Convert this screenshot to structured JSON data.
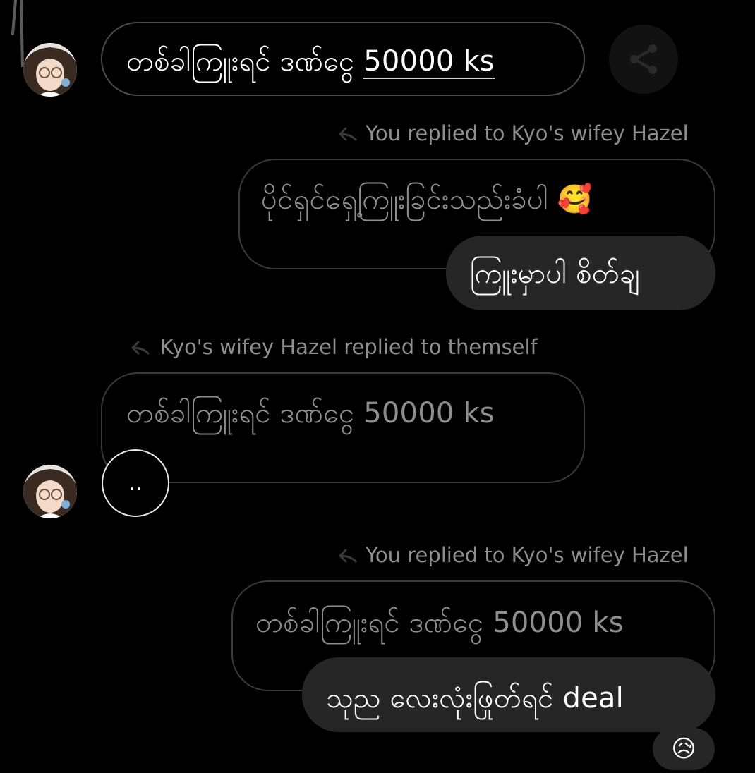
{
  "messages": [
    {
      "text_main": "တစ်ခါကြူးရင် ဒဏ်ငွေ",
      "amount": "50000 ks"
    },
    {
      "reply_label": "You replied to Kyo's wifey Hazel",
      "quoted_text": "ပိုင်ရှင်ရှေ့ကြူးခြင်းသည်းခံပါ",
      "quoted_emoji": "🥰",
      "reply_text": "ကြူးမှာပါ စိတ်ချ"
    },
    {
      "reply_label": "Kyo's wifey Hazel replied to themself",
      "quoted_text": "တစ်ခါကြူးရင် ဒဏ်ငွေ 50000 ks",
      "reaction": ".."
    },
    {
      "reply_label": "You replied to Kyo's wifey Hazel",
      "quoted_text": "တစ်ခါကြူးရင် ဒဏ်ငွေ 50000 ks",
      "reply_text": "သုည လေးလုံးဖြုတ်ရင် deal",
      "reaction_emoji": "😥"
    }
  ],
  "icons": {
    "share": "share-icon",
    "reply": "reply-arrow-icon"
  },
  "colors": {
    "background": "#000000",
    "bubble_fill": "#262626",
    "bubble_border": "#3a3a3a",
    "muted_text": "#8e8e8e"
  }
}
